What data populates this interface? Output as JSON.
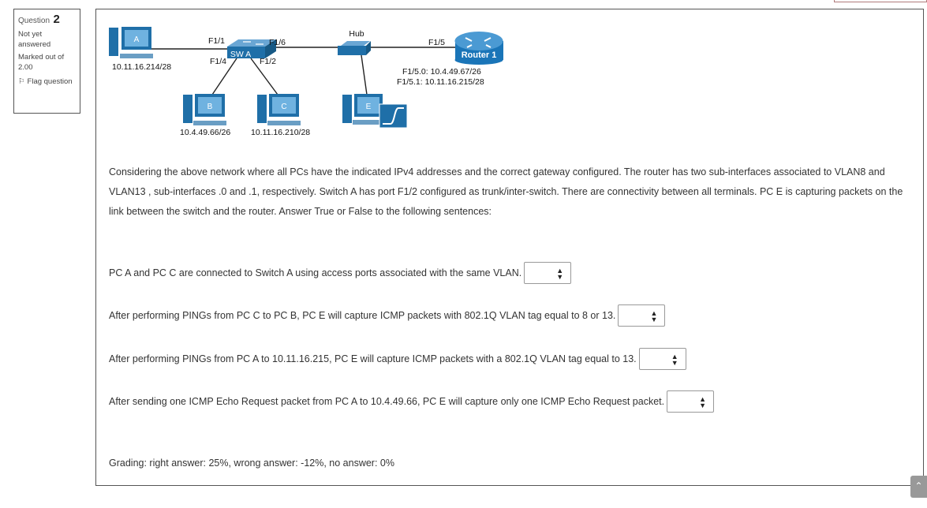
{
  "sidebar": {
    "question_label": "Question",
    "question_number": "2",
    "status": "Not yet answered",
    "marked": "Marked out of 2.00",
    "flag_label": "Flag question"
  },
  "diagram": {
    "pc_a": {
      "letter": "A",
      "ip": "10.11.16.214/28"
    },
    "pc_b": {
      "letter": "B",
      "ip": "10.4.49.66/26"
    },
    "pc_c": {
      "letter": "C",
      "ip": "10.11.16.210/28"
    },
    "pc_e": {
      "letter": "E"
    },
    "switch_label": "SW A",
    "hub_label": "Hub",
    "router_label": "Router 1",
    "ports": {
      "f11": "F1/1",
      "f16": "F1/6",
      "f14": "F1/4",
      "f12": "F1/2",
      "f15": "F1/5"
    },
    "router_if1": "F1/5.0: 10.4.49.67/26",
    "router_if2": "F1/5.1: 10.11.16.215/28"
  },
  "question_text": "Considering the above network where all PCs have the indicated IPv4 addresses and the correct gateway configured. The router has two sub-interfaces associated to VLAN8 and VLAN13 , sub-interfaces .0 and .1, respectively. Switch A has port F1/2 configured as trunk/inter-switch. There are connectivity between all terminals. PC E is capturing packets on the link between the switch and the router. Answer True or False to the following sentences:",
  "statements": [
    {
      "text": "PC A and PC C are connected to Switch A using access ports associated with the same VLAN.",
      "selected": ""
    },
    {
      "text": "After performing PINGs from PC C to PC B, PC E will capture ICMP packets with 802.1Q VLAN tag equal to 8 or 13.",
      "selected": ""
    },
    {
      "text": "After performing PINGs from PC A to 10.11.16.215, PC E will capture ICMP packets with a 802.1Q VLAN tag equal to 13.",
      "selected": ""
    },
    {
      "text": "After sending one ICMP Echo Request packet from PC A to 10.4.49.66, PC E will capture only one ICMP Echo Request packet.",
      "selected": ""
    }
  ],
  "grading": "Grading: right answer: 25%, wrong answer: -12%, no answer: 0%",
  "colors": {
    "pc_blue": "#1f6fa8",
    "router_blue": "#1a75b8",
    "link": "#222222"
  }
}
